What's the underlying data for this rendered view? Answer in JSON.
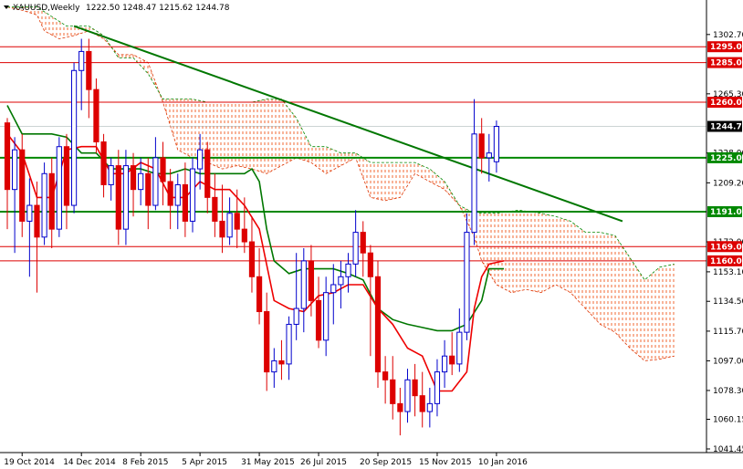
{
  "header": {
    "symbol": "XAUUSD,Weekly",
    "ohlc": "1222.50 1248.47 1215.62 1244.78"
  },
  "colors": {
    "bull": "#0000cc",
    "bear": "#dd0000",
    "tenkan": "#ee0000",
    "kijun": "#007700",
    "senkou_a_line": "#dd3300",
    "senkou_b_line": "#008800",
    "cloud_fill": "#ee4400",
    "resistance": "#dd0000",
    "support": "#008800",
    "trendline": "#007700",
    "last_price_bg": "#000000"
  },
  "chart_data": {
    "type": "candlestick",
    "ylim": [
      1041.45,
      1321.0
    ],
    "yticks": [
      {
        "label": "1302.70",
        "value": 1302.7
      },
      {
        "label": "1265.30",
        "value": 1265.3
      },
      {
        "label": "1228.00",
        "value": 1228.0
      },
      {
        "label": "1209.20",
        "value": 1209.2
      },
      {
        "label": "1172.00",
        "value": 1172.0
      },
      {
        "label": "1153.10",
        "value": 1153.1
      },
      {
        "label": "1134.50",
        "value": 1134.5
      },
      {
        "label": "1115.70",
        "value": 1115.7
      },
      {
        "label": "1097.00",
        "value": 1097.0
      },
      {
        "label": "1078.30",
        "value": 1078.3
      },
      {
        "label": "1060.15",
        "value": 1060.15
      },
      {
        "label": "1041.45",
        "value": 1041.45
      }
    ],
    "xticks": [
      {
        "label": "19 Oct 2014",
        "bar": 2
      },
      {
        "label": "14 Dec 2014",
        "bar": 10
      },
      {
        "label": "8 Feb 2015",
        "bar": 18
      },
      {
        "label": "5 Apr 2015",
        "bar": 26
      },
      {
        "label": "31 May 2015",
        "bar": 34
      },
      {
        "label": "26 Jul 2015",
        "bar": 42
      },
      {
        "label": "20 Sep 2015",
        "bar": 50
      },
      {
        "label": "15 Nov 2015",
        "bar": 58
      },
      {
        "label": "10 Jan 2016",
        "bar": 66
      }
    ],
    "levels": [
      {
        "label": "1295.00",
        "value": 1295.0,
        "kind": "resistance"
      },
      {
        "label": "1285.00",
        "value": 1285.0,
        "kind": "resistance"
      },
      {
        "label": "1260.00",
        "value": 1260.0,
        "kind": "resistance"
      },
      {
        "label": "1225.00",
        "value": 1225.0,
        "kind": "support"
      },
      {
        "label": "1191.00",
        "value": 1191.0,
        "kind": "support"
      },
      {
        "label": "1169.00",
        "value": 1169.0,
        "kind": "resistance"
      },
      {
        "label": "1160.00",
        "value": 1160.0,
        "kind": "resistance"
      }
    ],
    "last_price": {
      "label": "1244.78",
      "value": 1244.78
    },
    "trendline": {
      "from": [
        9,
        1308
      ],
      "to": [
        83,
        1185
      ]
    },
    "candles": [
      [
        1247,
        1250,
        1180,
        1205
      ],
      [
        1205,
        1238,
        1165,
        1230
      ],
      [
        1230,
        1240,
        1175,
        1185
      ],
      [
        1185,
        1212,
        1150,
        1195
      ],
      [
        1195,
        1210,
        1140,
        1175
      ],
      [
        1175,
        1222,
        1170,
        1215
      ],
      [
        1215,
        1225,
        1168,
        1180
      ],
      [
        1180,
        1238,
        1175,
        1232
      ],
      [
        1232,
        1240,
        1180,
        1195
      ],
      [
        1195,
        1285,
        1190,
        1280
      ],
      [
        1280,
        1300,
        1255,
        1292
      ],
      [
        1292,
        1300,
        1250,
        1268
      ],
      [
        1268,
        1275,
        1228,
        1235
      ],
      [
        1235,
        1240,
        1200,
        1208
      ],
      [
        1208,
        1225,
        1198,
        1220
      ],
      [
        1220,
        1230,
        1170,
        1180
      ],
      [
        1180,
        1230,
        1170,
        1220
      ],
      [
        1220,
        1228,
        1188,
        1205
      ],
      [
        1205,
        1225,
        1195,
        1215
      ],
      [
        1215,
        1225,
        1180,
        1195
      ],
      [
        1195,
        1238,
        1192,
        1225
      ],
      [
        1225,
        1235,
        1195,
        1210
      ],
      [
        1210,
        1218,
        1180,
        1195
      ],
      [
        1195,
        1215,
        1180,
        1208
      ],
      [
        1208,
        1222,
        1175,
        1185
      ],
      [
        1185,
        1225,
        1178,
        1218
      ],
      [
        1218,
        1240,
        1205,
        1230
      ],
      [
        1230,
        1235,
        1190,
        1200
      ],
      [
        1200,
        1215,
        1175,
        1185
      ],
      [
        1185,
        1208,
        1165,
        1175
      ],
      [
        1175,
        1200,
        1170,
        1190
      ],
      [
        1190,
        1205,
        1168,
        1180
      ],
      [
        1180,
        1200,
        1165,
        1172
      ],
      [
        1172,
        1188,
        1140,
        1150
      ],
      [
        1150,
        1168,
        1120,
        1128
      ],
      [
        1128,
        1140,
        1078,
        1090
      ],
      [
        1090,
        1105,
        1080,
        1097
      ],
      [
        1097,
        1110,
        1085,
        1095
      ],
      [
        1095,
        1125,
        1085,
        1120
      ],
      [
        1120,
        1165,
        1110,
        1130
      ],
      [
        1130,
        1168,
        1115,
        1160
      ],
      [
        1160,
        1170,
        1125,
        1135
      ],
      [
        1135,
        1150,
        1105,
        1110
      ],
      [
        1110,
        1150,
        1100,
        1140
      ],
      [
        1140,
        1158,
        1120,
        1145
      ],
      [
        1145,
        1160,
        1130,
        1150
      ],
      [
        1150,
        1165,
        1140,
        1158
      ],
      [
        1158,
        1192,
        1150,
        1178
      ],
      [
        1178,
        1185,
        1150,
        1165
      ],
      [
        1165,
        1170,
        1100,
        1150
      ],
      [
        1150,
        1160,
        1080,
        1090
      ],
      [
        1090,
        1100,
        1070,
        1085
      ],
      [
        1085,
        1100,
        1060,
        1070
      ],
      [
        1070,
        1080,
        1050,
        1065
      ],
      [
        1065,
        1092,
        1058,
        1085
      ],
      [
        1085,
        1095,
        1062,
        1075
      ],
      [
        1075,
        1090,
        1055,
        1065
      ],
      [
        1065,
        1080,
        1055,
        1070
      ],
      [
        1070,
        1098,
        1062,
        1090
      ],
      [
        1090,
        1110,
        1080,
        1100
      ],
      [
        1100,
        1115,
        1088,
        1095
      ],
      [
        1095,
        1130,
        1090,
        1115
      ],
      [
        1115,
        1190,
        1110,
        1178
      ],
      [
        1178,
        1262,
        1170,
        1240
      ],
      [
        1240,
        1250,
        1215,
        1225
      ],
      [
        1225,
        1240,
        1210,
        1228
      ],
      [
        1222.5,
        1248.47,
        1215.62,
        1244.78
      ]
    ],
    "tenkan": [
      [
        0,
        1240
      ],
      [
        2,
        1228
      ],
      [
        4,
        1200
      ],
      [
        6,
        1200
      ],
      [
        8,
        1230
      ],
      [
        10,
        1232
      ],
      [
        12,
        1232
      ],
      [
        14,
        1215
      ],
      [
        16,
        1215
      ],
      [
        18,
        1222
      ],
      [
        20,
        1218
      ],
      [
        22,
        1200
      ],
      [
        24,
        1200
      ],
      [
        26,
        1210
      ],
      [
        28,
        1205
      ],
      [
        30,
        1205
      ],
      [
        32,
        1195
      ],
      [
        34,
        1180
      ],
      [
        36,
        1135
      ],
      [
        38,
        1130
      ],
      [
        40,
        1128
      ],
      [
        42,
        1138
      ],
      [
        44,
        1140
      ],
      [
        46,
        1145
      ],
      [
        48,
        1145
      ],
      [
        50,
        1130
      ],
      [
        52,
        1120
      ],
      [
        54,
        1105
      ],
      [
        56,
        1100
      ],
      [
        58,
        1078
      ],
      [
        60,
        1078
      ],
      [
        62,
        1090
      ],
      [
        63,
        1130
      ],
      [
        64,
        1150
      ],
      [
        65,
        1158
      ],
      [
        67,
        1160
      ]
    ],
    "kijun": [
      [
        0,
        1258
      ],
      [
        2,
        1240
      ],
      [
        4,
        1240
      ],
      [
        6,
        1240
      ],
      [
        8,
        1238
      ],
      [
        10,
        1228
      ],
      [
        12,
        1228
      ],
      [
        14,
        1218
      ],
      [
        16,
        1218
      ],
      [
        18,
        1218
      ],
      [
        20,
        1215
      ],
      [
        22,
        1215
      ],
      [
        24,
        1218
      ],
      [
        26,
        1215
      ],
      [
        28,
        1215
      ],
      [
        30,
        1215
      ],
      [
        32,
        1215
      ],
      [
        33,
        1218
      ],
      [
        34,
        1210
      ],
      [
        35,
        1180
      ],
      [
        36,
        1160
      ],
      [
        38,
        1152
      ],
      [
        40,
        1155
      ],
      [
        42,
        1155
      ],
      [
        44,
        1155
      ],
      [
        46,
        1152
      ],
      [
        48,
        1148
      ],
      [
        50,
        1130
      ],
      [
        52,
        1123
      ],
      [
        54,
        1120
      ],
      [
        56,
        1118
      ],
      [
        58,
        1116
      ],
      [
        60,
        1116
      ],
      [
        62,
        1120
      ],
      [
        64,
        1135
      ],
      [
        65,
        1155
      ],
      [
        67,
        1155
      ]
    ],
    "senkou_a": [
      [
        0,
        1320
      ],
      [
        2,
        1318
      ],
      [
        4,
        1315
      ],
      [
        5,
        1305
      ],
      [
        7,
        1300
      ],
      [
        9,
        1302
      ],
      [
        11,
        1305
      ],
      [
        13,
        1300
      ],
      [
        15,
        1290
      ],
      [
        17,
        1290
      ],
      [
        19,
        1285
      ],
      [
        21,
        1260
      ],
      [
        23,
        1230
      ],
      [
        25,
        1225
      ],
      [
        27,
        1222
      ],
      [
        29,
        1218
      ],
      [
        31,
        1220
      ],
      [
        33,
        1218
      ],
      [
        35,
        1215
      ],
      [
        37,
        1220
      ],
      [
        39,
        1225
      ],
      [
        41,
        1222
      ],
      [
        43,
        1215
      ],
      [
        45,
        1220
      ],
      [
        47,
        1225
      ],
      [
        49,
        1200
      ],
      [
        51,
        1198
      ],
      [
        53,
        1200
      ],
      [
        55,
        1215
      ],
      [
        57,
        1210
      ],
      [
        59,
        1205
      ],
      [
        61,
        1195
      ],
      [
        63,
        1175
      ],
      [
        64,
        1160
      ],
      [
        66,
        1145
      ],
      [
        68,
        1140
      ],
      [
        70,
        1142
      ],
      [
        72,
        1140
      ],
      [
        74,
        1145
      ],
      [
        76,
        1140
      ],
      [
        78,
        1130
      ],
      [
        80,
        1120
      ],
      [
        82,
        1115
      ],
      [
        84,
        1105
      ],
      [
        86,
        1097
      ],
      [
        88,
        1098
      ],
      [
        90,
        1100
      ]
    ],
    "senkou_b": [
      [
        0,
        1320
      ],
      [
        4,
        1320
      ],
      [
        8,
        1308
      ],
      [
        11,
        1308
      ],
      [
        13,
        1302
      ],
      [
        15,
        1288
      ],
      [
        17,
        1288
      ],
      [
        19,
        1278
      ],
      [
        21,
        1262
      ],
      [
        25,
        1262
      ],
      [
        27,
        1260
      ],
      [
        29,
        1260
      ],
      [
        31,
        1260
      ],
      [
        33,
        1260
      ],
      [
        35,
        1262
      ],
      [
        37,
        1262
      ],
      [
        39,
        1250
      ],
      [
        41,
        1232
      ],
      [
        43,
        1232
      ],
      [
        45,
        1228
      ],
      [
        47,
        1228
      ],
      [
        49,
        1222
      ],
      [
        51,
        1222
      ],
      [
        53,
        1222
      ],
      [
        55,
        1222
      ],
      [
        57,
        1218
      ],
      [
        59,
        1210
      ],
      [
        61,
        1195
      ],
      [
        63,
        1190
      ],
      [
        66,
        1190
      ],
      [
        69,
        1192
      ],
      [
        72,
        1190
      ],
      [
        74,
        1188
      ],
      [
        76,
        1185
      ],
      [
        78,
        1178
      ],
      [
        80,
        1178
      ],
      [
        82,
        1176
      ],
      [
        84,
        1162
      ],
      [
        86,
        1148
      ],
      [
        87,
        1152
      ],
      [
        88,
        1156
      ],
      [
        90,
        1158
      ]
    ]
  },
  "plot": {
    "bars_visible": 90
  }
}
